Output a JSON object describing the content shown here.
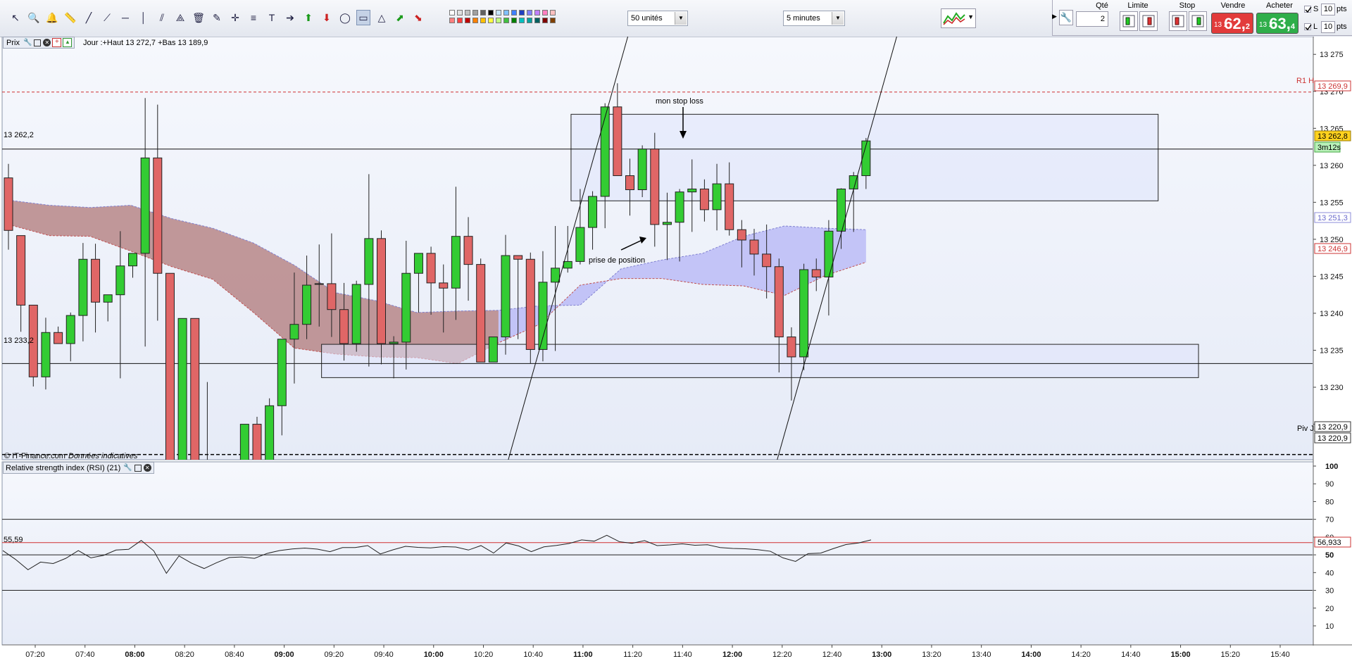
{
  "toolbar": {
    "tools": [
      "pointer-icon",
      "zoom-icon",
      "alert-bell-icon",
      "ruler-icon",
      "trendline-icon",
      "ray-line-icon",
      "horizontal-line-icon",
      "vertical-line-icon",
      "channel-icon",
      "fan-icon",
      "trash-icon",
      "magic-icon",
      "cross-cursor-icon",
      "fibonacci-icon",
      "text-tool-icon",
      "arrow-icon",
      "up-arrow-icon",
      "down-arrow-icon",
      "ellipse-icon",
      "rectangle-icon",
      "triangle-icon",
      "up-trend-icon",
      "down-trend-icon"
    ],
    "units_select": "50 unités",
    "interval_select": "5 minutes"
  },
  "order": {
    "qty_label": "Qté",
    "qty_value": "2",
    "limit_label": "Limite",
    "stop_label": "Stop",
    "sell_label": "Vendre",
    "buy_label": "Acheter",
    "sell_prefix": "13 2",
    "sell_big": "62,",
    "sell_small": "2",
    "buy_prefix": "13 2",
    "buy_big": "63,",
    "buy_small": "4",
    "s_label": "S",
    "l_label": "L",
    "s_value": "10",
    "l_value": "10",
    "pts": "pts",
    "colors": {
      "sell": "#e23b3b",
      "buy": "#2fae4a"
    }
  },
  "price_panel": {
    "title": "Prix",
    "info": "Jour :+Haut 13 272,7 +Bas 13 189,9",
    "copyright": "© IT-Finance.com",
    "disclaimer": "Données indicatives",
    "ref_left_top": "13 262,2",
    "ref_left_bottom": "13 233,2",
    "r1_label": "R1 H",
    "piv_label": "Piv J",
    "tags": {
      "r1": "13 269,9",
      "current": "13 262,8",
      "timer": "3m12s",
      "cloud_top": "13 251,3",
      "cloud_bottom": "13 246,9",
      "piv1": "13 220,9",
      "piv2": "13 220,9"
    },
    "annotations": {
      "stop": "mon stop loss",
      "entry": "prise de position"
    },
    "colors": {
      "up": "#33cc33",
      "down": "#e06666",
      "cloud_red": "#b07878",
      "cloud_blue": "#b4b4f5",
      "bg": "#eef1fb",
      "tag_current": "#ffd21e",
      "tag_timer": "#b8f0b8"
    }
  },
  "rsi_panel": {
    "title": "Relative strength index (RSI) (21)",
    "left_value": "55,59",
    "tag": "56,933",
    "ticks": [
      "100",
      "90",
      "80",
      "70",
      "60",
      "50",
      "40",
      "30",
      "20",
      "10"
    ]
  },
  "chart_data": {
    "type": "candlestick",
    "y_ticks": [
      "13 275",
      "13 270",
      "13 265",
      "13 260",
      "13 255",
      "13 250",
      "13 245",
      "13 240",
      "13 235",
      "13 230",
      "13 225"
    ],
    "ylim": [
      13220.2,
      13277.4
    ],
    "time_labels": [
      {
        "t": "07:20",
        "bold": false
      },
      {
        "t": "07:40",
        "bold": false
      },
      {
        "t": "08:00",
        "bold": true
      },
      {
        "t": "08:20",
        "bold": false
      },
      {
        "t": "08:40",
        "bold": false
      },
      {
        "t": "09:00",
        "bold": true
      },
      {
        "t": "09:20",
        "bold": false
      },
      {
        "t": "09:40",
        "bold": false
      },
      {
        "t": "10:00",
        "bold": true
      },
      {
        "t": "10:20",
        "bold": false
      },
      {
        "t": "10:40",
        "bold": false
      },
      {
        "t": "11:00",
        "bold": true
      },
      {
        "t": "11:20",
        "bold": false
      },
      {
        "t": "11:40",
        "bold": false
      },
      {
        "t": "12:00",
        "bold": true
      },
      {
        "t": "12:20",
        "bold": false
      },
      {
        "t": "12:40",
        "bold": false
      },
      {
        "t": "13:00",
        "bold": true
      },
      {
        "t": "13:20",
        "bold": false
      },
      {
        "t": "13:40",
        "bold": false
      },
      {
        "t": "14:00",
        "bold": true
      },
      {
        "t": "14:20",
        "bold": false
      },
      {
        "t": "14:40",
        "bold": false
      },
      {
        "t": "15:00",
        "bold": true
      },
      {
        "t": "15:20",
        "bold": false
      },
      {
        "t": "15:40",
        "bold": false
      }
    ],
    "levels": {
      "r1": 13269.9,
      "pivot": 13220.9,
      "ref_top": 13262.2,
      "ref_bottom": 13233.2
    },
    "zones": [
      {
        "t1": 10.92,
        "t2": 14.85,
        "top": 13266.9,
        "bottom": 13255.2
      },
      {
        "t1": 9.25,
        "t2": 15.12,
        "top": 13235.8,
        "bottom": 13231.3
      }
    ],
    "trendlines": [
      {
        "t1": 10.5,
        "p1": 13220.2,
        "t2": 11.3,
        "p2": 13277.4
      },
      {
        "t1": 12.3,
        "p1": 13220.2,
        "t2": 13.1,
        "p2": 13277.4
      }
    ],
    "candles": [
      [
        13258.3,
        13260.2,
        13248.6,
        13251.2
      ],
      [
        13250.5,
        13250.5,
        13237.5,
        13241.1
      ],
      [
        13241.1,
        13241.1,
        13230.1,
        13231.4
      ],
      [
        13231.4,
        13239.4,
        13229.7,
        13237.4
      ],
      [
        13237.4,
        13238.2,
        13235.9,
        13235.9
      ],
      [
        13235.9,
        13240.1,
        13233.5,
        13239.7
      ],
      [
        13239.7,
        13249.5,
        13236.2,
        13247.3
      ],
      [
        13247.3,
        13249.4,
        13237.4,
        13241.5
      ],
      [
        13241.5,
        13242.5,
        13238.9,
        13242.5
      ],
      [
        13242.5,
        13251.1,
        13231.2,
        13246.4
      ],
      [
        13246.4,
        13248.1,
        13244.8,
        13248.1
      ],
      [
        13248.1,
        13269.1,
        13235.5,
        13261.0
      ],
      [
        13261.0,
        13268.2,
        13239.0,
        13245.4
      ],
      [
        13245.4,
        13245.4,
        13212.0,
        13212.0
      ],
      [
        13212.0,
        13233.0,
        13190.0,
        13239.3
      ],
      [
        13239.3,
        13239.3,
        13210.0,
        13220.0
      ],
      [
        13220.0,
        13230.7,
        13210.0,
        13212.0
      ],
      [
        13212.0,
        13213.0,
        13200.0,
        13200.0
      ],
      [
        13200.0,
        13212.0,
        13199.0,
        13211.0
      ],
      [
        13211.0,
        13223.0,
        13205.0,
        13225.0
      ],
      [
        13225.0,
        13226.0,
        13212.0,
        13219.0
      ],
      [
        13219.0,
        13228.5,
        13220.5,
        13227.5
      ],
      [
        13227.5,
        13236.5,
        13223.5,
        13236.5
      ],
      [
        13236.5,
        13245.5,
        13230.5,
        13238.5
      ],
      [
        13238.5,
        13247.8,
        13236.5,
        13243.8
      ],
      [
        13244.0,
        13249.3,
        13238.2,
        13244.0
      ],
      [
        13244.0,
        13250.8,
        13236.8,
        13240.5
      ],
      [
        13240.5,
        13244.1,
        13233.6,
        13235.9
      ],
      [
        13235.9,
        13244.4,
        13234.8,
        13243.9
      ],
      [
        13243.9,
        13258.8,
        13232.8,
        13250.1
      ],
      [
        13250.1,
        13251.2,
        13233.1,
        13235.9
      ],
      [
        13235.9,
        13236.9,
        13231.2,
        13236.1
      ],
      [
        13236.1,
        13249.8,
        13232.4,
        13245.4
      ],
      [
        13245.4,
        13247.4,
        13240.1,
        13248.1
      ],
      [
        13248.1,
        13249.0,
        13239.8,
        13244.1
      ],
      [
        13244.1,
        13246.6,
        13237.4,
        13243.4
      ],
      [
        13243.4,
        13257.1,
        13239.1,
        13250.4
      ],
      [
        13250.4,
        13253.0,
        13241.7,
        13246.6
      ],
      [
        13246.6,
        13247.4,
        13233.4,
        13233.4
      ],
      [
        13233.4,
        13236.8,
        13233.4,
        13236.8
      ],
      [
        13236.8,
        13250.6,
        13234.4,
        13247.8
      ],
      [
        13247.8,
        13247.8,
        13236.5,
        13247.3
      ],
      [
        13247.3,
        13248.2,
        13233.2,
        13235.1
      ],
      [
        13235.1,
        13248.4,
        13233.5,
        13244.2
      ],
      [
        13244.2,
        13251.8,
        13234.9,
        13246.1
      ],
      [
        13246.1,
        13251.8,
        13245.5,
        13247.0
      ],
      [
        13247.0,
        13256.8,
        13246.6,
        13251.6
      ],
      [
        13251.6,
        13256.5,
        13248.6,
        13255.8
      ],
      [
        13255.8,
        13268.4,
        13251.5,
        13267.9
      ],
      [
        13267.9,
        13271.1,
        13258.9,
        13258.6
      ],
      [
        13258.6,
        13260.9,
        13253.2,
        13256.7
      ],
      [
        13256.7,
        13262.7,
        13255.7,
        13262.2
      ],
      [
        13262.2,
        13264.4,
        13249.0,
        13252.0
      ],
      [
        13252.0,
        13256.3,
        13247.2,
        13252.3
      ],
      [
        13252.3,
        13256.8,
        13247.0,
        13256.4
      ],
      [
        13256.4,
        13260.8,
        13251.0,
        13256.8
      ],
      [
        13256.8,
        13258.1,
        13252.4,
        13254.0
      ],
      [
        13254.0,
        13260.2,
        13251.2,
        13257.5
      ],
      [
        13257.5,
        13260.4,
        13250.5,
        13251.3
      ],
      [
        13251.3,
        13252.6,
        13246.2,
        13249.9
      ],
      [
        13249.9,
        13251.4,
        13245.1,
        13248.0
      ],
      [
        13248.0,
        13252.0,
        13242.0,
        13246.3
      ],
      [
        13246.3,
        13247.4,
        13232.0,
        13236.8
      ],
      [
        13236.8,
        13238.1,
        13228.2,
        13234.1
      ],
      [
        13234.1,
        13246.7,
        13232.3,
        13245.9
      ],
      [
        13245.9,
        13247.4,
        13243.0,
        13244.9
      ],
      [
        13244.9,
        13252.6,
        13239.7,
        13251.1
      ],
      [
        13251.1,
        13256.9,
        13248.7,
        13256.8
      ],
      [
        13256.8,
        13259.1,
        13251.0,
        13258.6
      ],
      [
        13258.6,
        13263.7,
        13256.8,
        13263.3
      ]
    ],
    "cloud_upper": [
      13255.3,
      13254.6,
      13254.3,
      13254.6,
      13252.8,
      13251.5,
      13249.5,
      13246.5,
      13242.8,
      13241.7,
      13240.1,
      13240.3,
      13240.4,
      13241.0,
      13241.1,
      13246.0,
      13247.2,
      13248.1,
      13250.4,
      13251.8,
      13251.5,
      13251.3
    ],
    "cloud_lower": [
      13252.0,
      13250.5,
      13250.4,
      13248.4,
      13246.3,
      13244.6,
      13240.1,
      13235.3,
      13234.5,
      13234.1,
      13234.0,
      13233.2,
      13236.0,
      13238.5,
      13243.8,
      13244.7,
      13244.7,
      13243.9,
      13243.7,
      13242.4,
      13245.1,
      13246.9
    ],
    "rsi": [
      52.4,
      47.5,
      41.6,
      45.9,
      45.1,
      48.0,
      52.4,
      48.3,
      49.7,
      52.7,
      53.1,
      58.1,
      52.2,
      39.6,
      49.4,
      45.3,
      42.3,
      45.6,
      48.5,
      48.8,
      48.0,
      50.8,
      52.4,
      53.3,
      53.8,
      53.2,
      51.8,
      54.1,
      54.1,
      55.2,
      50.5,
      52.8,
      54.8,
      54.2,
      53.9,
      54.6,
      54.4,
      52.7,
      55.2,
      51.0,
      56.7,
      55.0,
      51.8,
      54.5,
      55.3,
      56.4,
      58.4,
      57.7,
      61.0,
      57.4,
      56.5,
      58.0,
      55.2,
      55.6,
      56.2,
      55.4,
      55.7,
      54.1,
      53.6,
      53.4,
      52.9,
      52.0,
      48.3,
      46.3,
      50.7,
      51.0,
      53.5,
      55.8,
      56.7,
      58.4
    ]
  }
}
